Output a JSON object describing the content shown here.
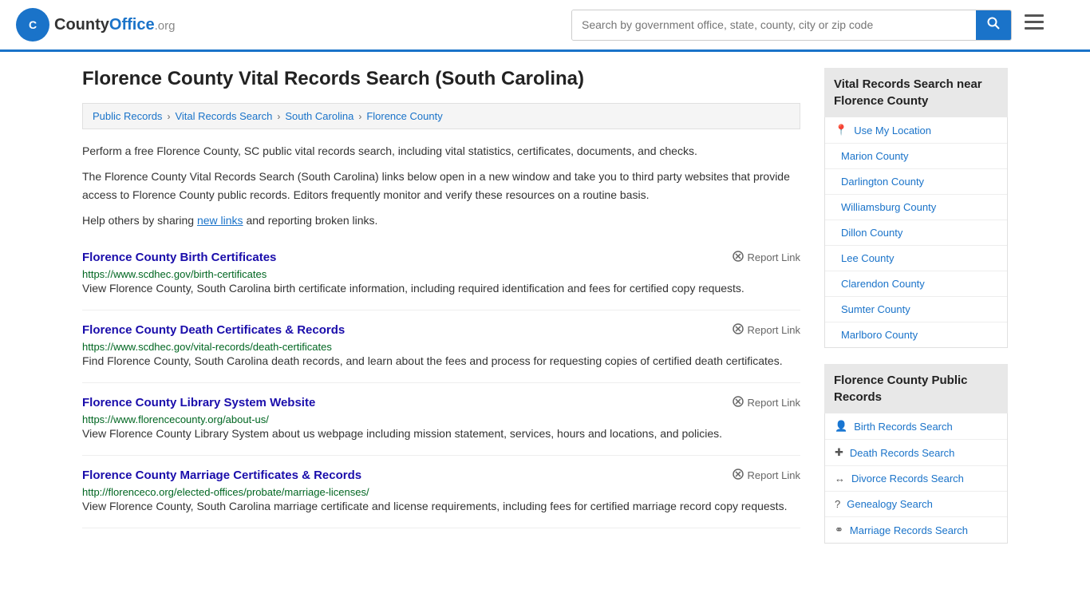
{
  "header": {
    "logo_text": "County",
    "logo_org": "Office.org",
    "search_placeholder": "Search by government office, state, county, city or zip code",
    "search_label": "🔍",
    "menu_label": "≡"
  },
  "page": {
    "title": "Florence County Vital Records Search (South Carolina)",
    "breadcrumb": [
      {
        "label": "Public Records",
        "href": "#"
      },
      {
        "label": "Vital Records Search",
        "href": "#"
      },
      {
        "label": "South Carolina",
        "href": "#"
      },
      {
        "label": "Florence County",
        "href": "#"
      }
    ],
    "description1": "Perform a free Florence County, SC public vital records search, including vital statistics, certificates, documents, and checks.",
    "description2": "The Florence County Vital Records Search (South Carolina) links below open in a new window and take you to third party websites that provide access to Florence County public records. Editors frequently monitor and verify these resources on a routine basis.",
    "description3_prefix": "Help others by sharing ",
    "description3_link": "new links",
    "description3_suffix": " and reporting broken links.",
    "records": [
      {
        "title": "Florence County Birth Certificates",
        "url": "https://www.scdhec.gov/birth-certificates",
        "description": "View Florence County, South Carolina birth certificate information, including required identification and fees for certified copy requests.",
        "report_label": "Report Link"
      },
      {
        "title": "Florence County Death Certificates & Records",
        "url": "https://www.scdhec.gov/vital-records/death-certificates",
        "description": "Find Florence County, South Carolina death records, and learn about the fees and process for requesting copies of certified death certificates.",
        "report_label": "Report Link"
      },
      {
        "title": "Florence County Library System Website",
        "url": "https://www.florencecounty.org/about-us/",
        "description": "View Florence County Library System about us webpage including mission statement, services, hours and locations, and policies.",
        "report_label": "Report Link"
      },
      {
        "title": "Florence County Marriage Certificates & Records",
        "url": "http://florenceco.org/elected-offices/probate/marriage-licenses/",
        "description": "View Florence County, South Carolina marriage certificate and license requirements, including fees for certified marriage record copy requests.",
        "report_label": "Report Link"
      }
    ]
  },
  "sidebar": {
    "nearby_section": {
      "header": "Vital Records Search near Florence County",
      "items": [
        {
          "label": "Use My Location",
          "icon": "📍",
          "href": "#"
        },
        {
          "label": "Marion County",
          "icon": "",
          "href": "#"
        },
        {
          "label": "Darlington County",
          "icon": "",
          "href": "#"
        },
        {
          "label": "Williamsburg County",
          "icon": "",
          "href": "#"
        },
        {
          "label": "Dillon County",
          "icon": "",
          "href": "#"
        },
        {
          "label": "Lee County",
          "icon": "",
          "href": "#"
        },
        {
          "label": "Clarendon County",
          "icon": "",
          "href": "#"
        },
        {
          "label": "Sumter County",
          "icon": "",
          "href": "#"
        },
        {
          "label": "Marlboro County",
          "icon": "",
          "href": "#"
        }
      ]
    },
    "public_records_section": {
      "header": "Florence County Public Records",
      "items": [
        {
          "label": "Birth Records Search",
          "icon": "👤",
          "href": "#"
        },
        {
          "label": "Death Records Search",
          "icon": "+",
          "href": "#"
        },
        {
          "label": "Divorce Records Search",
          "icon": "↔",
          "href": "#"
        },
        {
          "label": "Genealogy Search",
          "icon": "?",
          "href": "#"
        },
        {
          "label": "Marriage Records Search",
          "icon": "⚭",
          "href": "#"
        }
      ]
    }
  }
}
